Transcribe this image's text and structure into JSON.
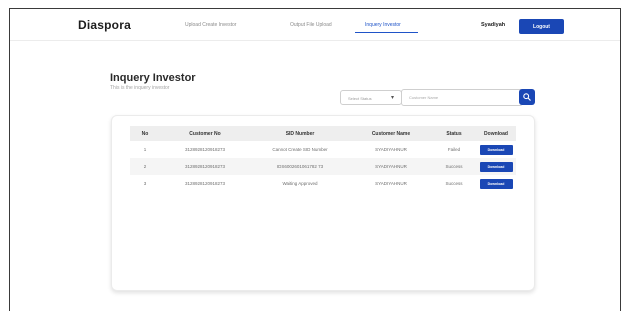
{
  "app": {
    "logo": "Diaspora"
  },
  "nav": {
    "links": [
      {
        "label": "Upload Create Investor",
        "active": false
      },
      {
        "label": "Output File Upload",
        "active": false
      },
      {
        "label": "Inquery Investor",
        "active": true
      }
    ],
    "user": "Syadiyah",
    "logout_label": "Logout"
  },
  "page": {
    "title": "Inquery Investor",
    "subtitle": "This is the inquery investor"
  },
  "filters": {
    "status_select": "Select Status",
    "search_placeholder": "Customer Name"
  },
  "table": {
    "headers": [
      "No",
      "Customer No",
      "SID Number",
      "Customer Name",
      "Status",
      "Download"
    ],
    "rows": [
      {
        "no": "1",
        "customer_no": "3128928120918273",
        "sid_number": "Cannot Create SID Number",
        "customer_name": "SYADIYAHNUR",
        "status": "Failed",
        "download": "Download"
      },
      {
        "no": "2",
        "customer_no": "3128928120918273",
        "sid_number": "IDS6002601061782 73",
        "customer_name": "SYADIYAHNUR",
        "status": "Success",
        "download": "Download"
      },
      {
        "no": "3",
        "customer_no": "3128928120918273",
        "sid_number": "Waiting Approved",
        "customer_name": "SYADIYAHNUR",
        "status": "Success",
        "download": "Download"
      }
    ]
  },
  "colors": {
    "primary": "#1a47b5",
    "active_link": "#1f54c8",
    "header_row": "#eeeeee"
  },
  "icons": {
    "search": "search-icon",
    "select": "chevron-down-icon"
  }
}
